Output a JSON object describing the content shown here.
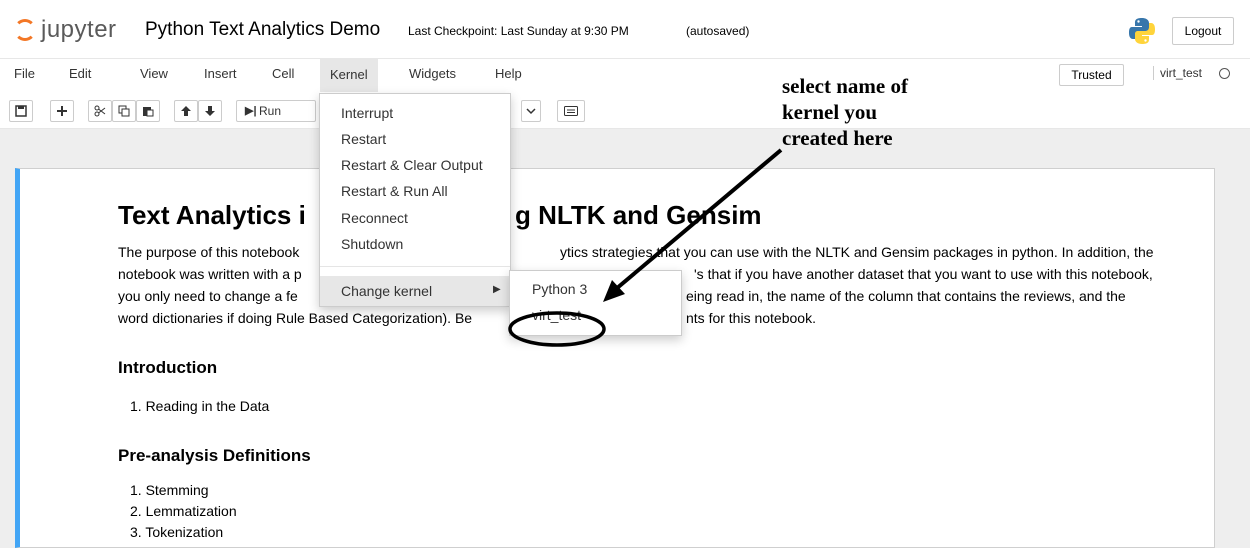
{
  "header": {
    "logo_text": "jupyter",
    "notebook_title": "Python Text Analytics Demo",
    "checkpoint": "Last Checkpoint: Last Sunday at 9:30 PM",
    "autosave": "(autosaved)",
    "logout_label": "Logout",
    "python_logo_icon": "python-logo-icon"
  },
  "menubar": {
    "items": [
      "File",
      "Edit",
      "View",
      "Insert",
      "Cell",
      "Kernel",
      "Widgets",
      "Help"
    ],
    "active": "Kernel",
    "trusted_label": "Trusted",
    "kernel_name": "virt_test"
  },
  "toolbar": {
    "run_label": "Run",
    "icons": [
      "save-icon",
      "add-icon",
      "cut-icon",
      "copy-icon",
      "paste-icon",
      "move-up-icon",
      "move-down-icon"
    ]
  },
  "kernel_menu": {
    "items": [
      "Interrupt",
      "Restart",
      "Restart & Clear Output",
      "Restart & Run All",
      "Reconnect",
      "Shutdown"
    ],
    "change_kernel": "Change kernel",
    "submenu": [
      "Python 3",
      "virt_test"
    ]
  },
  "notebook": {
    "heading": "Text Analytics i",
    "heading_right": "g NLTK and Gensim",
    "paragraph_lines": [
      [
        "The purpose of this notebook",
        "ytics strategies that you can use with the NLTK and Gensim packages in python. In addition, the"
      ],
      [
        "notebook was written with a p",
        "'s that if you have another dataset that you want to use with this notebook,"
      ],
      [
        "you only need to change a fe",
        "eing read in, the name of the column that contains the reviews, and the"
      ],
      [
        "word dictionaries if doing Rule Based Categorization). Be",
        "nts for this notebook."
      ]
    ],
    "sections": [
      {
        "title": "Introduction",
        "items": [
          "1. Reading in the Data"
        ]
      },
      {
        "title": "Pre-analysis Definitions",
        "items": [
          "1. Stemming",
          "2. Lemmatization",
          "3. Tokenization"
        ]
      }
    ]
  },
  "annotation": {
    "lines": [
      "select name of",
      "kernel you",
      "created here"
    ]
  }
}
